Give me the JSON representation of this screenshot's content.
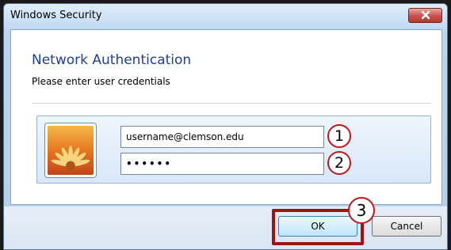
{
  "window": {
    "title": "Windows Security",
    "close_icon": "close-icon"
  },
  "dialog": {
    "heading": "Network Authentication",
    "subtitle": "Please enter user credentials"
  },
  "credentials": {
    "avatar_icon": "flower-avatar-icon",
    "username_value": "username@clemson.edu",
    "password_value": "••••••"
  },
  "annotations": {
    "step1": "1",
    "step2": "2",
    "step3": "3",
    "highlight_color": "#9e1414"
  },
  "buttons": {
    "ok_label": "OK",
    "cancel_label": "Cancel"
  }
}
